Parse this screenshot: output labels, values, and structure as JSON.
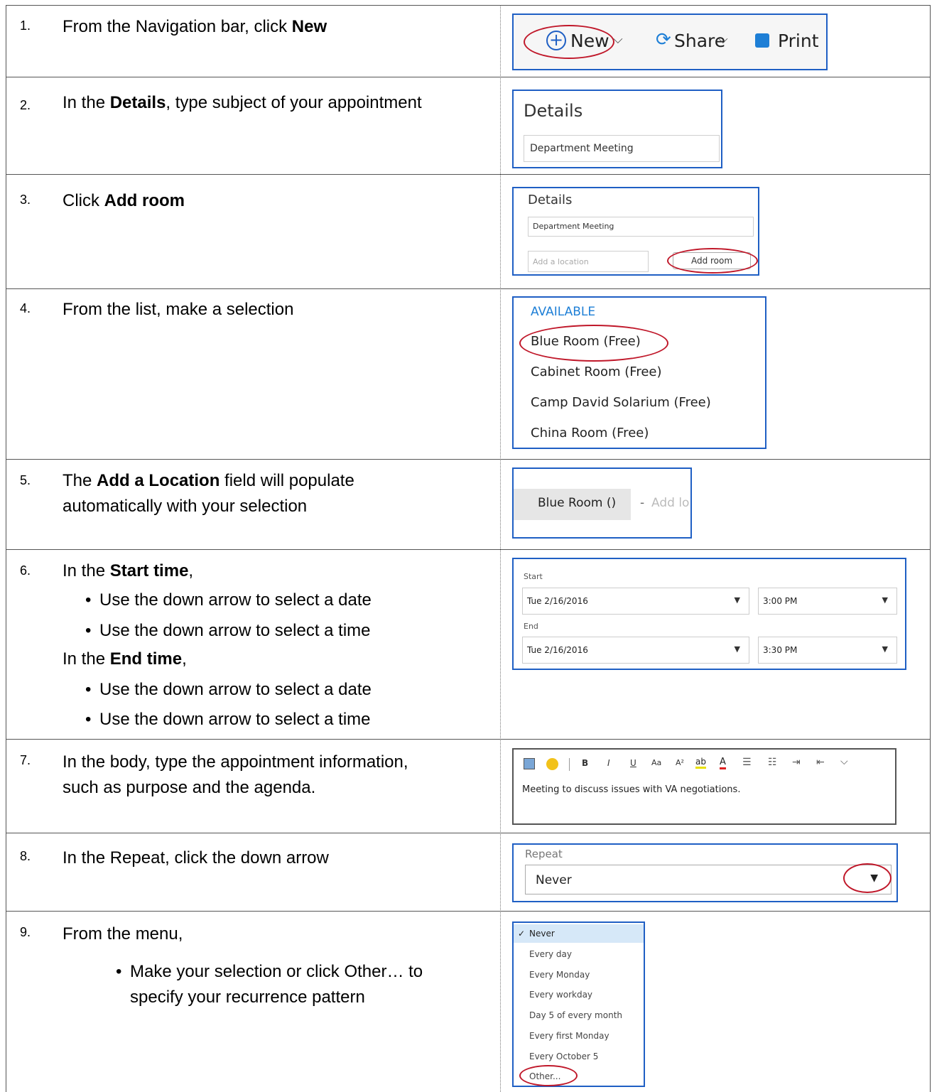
{
  "steps": [
    {
      "num": "1.",
      "pre": "From the Navigation bar, click ",
      "bold": "New"
    },
    {
      "num": "2.",
      "pre": "In the ",
      "bold": "Details",
      "post": ", type subject of your appointment"
    },
    {
      "num": "3.",
      "pre": "Click ",
      "bold": "Add room"
    },
    {
      "num": "4.",
      "text": "From the list, make a selection"
    },
    {
      "num": "5.",
      "pre": "The ",
      "bold": "Add a Location",
      "post": " field will populate",
      "line2": "automatically with your selection"
    },
    {
      "num": "6.",
      "pre": "In the ",
      "bold": "Start time",
      "post": ",",
      "bullet1": "Use the down arrow to select a date",
      "bullet2": "Use the down arrow to select a time",
      "pre2": "In the ",
      "bold2": "End time",
      "post2": ",",
      "bullet3": "Use the down arrow to select a date",
      "bullet4": "Use the down arrow to select a time"
    },
    {
      "num": "7.",
      "line1": "In the body, type the appointment information,",
      "line2": "such as purpose and the agenda."
    },
    {
      "num": "8.",
      "text": "In the Repeat, click the down arrow"
    },
    {
      "num": "9.",
      "text": "From the menu,",
      "bullet": "Make your selection or click Other… to",
      "bullet_line2": "specify your recurrence pattern"
    }
  ],
  "shot1": {
    "new": "New",
    "share": "Share",
    "print": "Print",
    "new_icon": "plus-circle-icon",
    "share_icon": "share-icon",
    "print_icon": "printer-icon",
    "chevron": "⌵"
  },
  "shot2": {
    "title": "Details",
    "subject": "Department Meeting"
  },
  "shot3": {
    "title": "Details",
    "subject": "Department Meeting",
    "location_placeholder": "Add a location",
    "add_room": "Add room"
  },
  "shot4": {
    "header": "AVAILABLE",
    "rooms": [
      "Blue Room  (Free)",
      "Cabinet Room  (Free)",
      "Camp David Solarium  (Free)",
      "China Room  (Free)"
    ]
  },
  "shot5": {
    "chip": "Blue Room ()",
    "sep": "-",
    "placeholder": "Add lo"
  },
  "shot6": {
    "start_label": "Start",
    "start_date": "Tue 2/16/2016",
    "start_time": "3:00 PM",
    "end_label": "End",
    "end_date": "Tue 2/16/2016",
    "end_time": "3:30 PM"
  },
  "shot7": {
    "body": "Meeting to discuss issues with VA negotiations.",
    "tools": [
      "image-icon",
      "emoji-icon",
      "separator",
      "bold-icon",
      "italic-icon",
      "underline-icon",
      "font-size-icon",
      "superscript-icon",
      "highlight-icon",
      "font-color-icon",
      "bullets-icon",
      "numbering-icon",
      "indent-icon",
      "outdent-icon",
      "more-icon"
    ]
  },
  "shot8": {
    "label": "Repeat",
    "value": "Never"
  },
  "shot9": {
    "options": [
      "Never",
      "Every day",
      "Every Monday",
      "Every workday",
      "Day 5 of every month",
      "Every first Monday",
      "Every October 5",
      "Other..."
    ],
    "selected": "Never"
  },
  "colors": {
    "accent_blue": "#1f5fc4",
    "annotation_red": "#c0182a",
    "link_blue": "#1e7fd6",
    "selected_bg": "#d6e8f8"
  }
}
